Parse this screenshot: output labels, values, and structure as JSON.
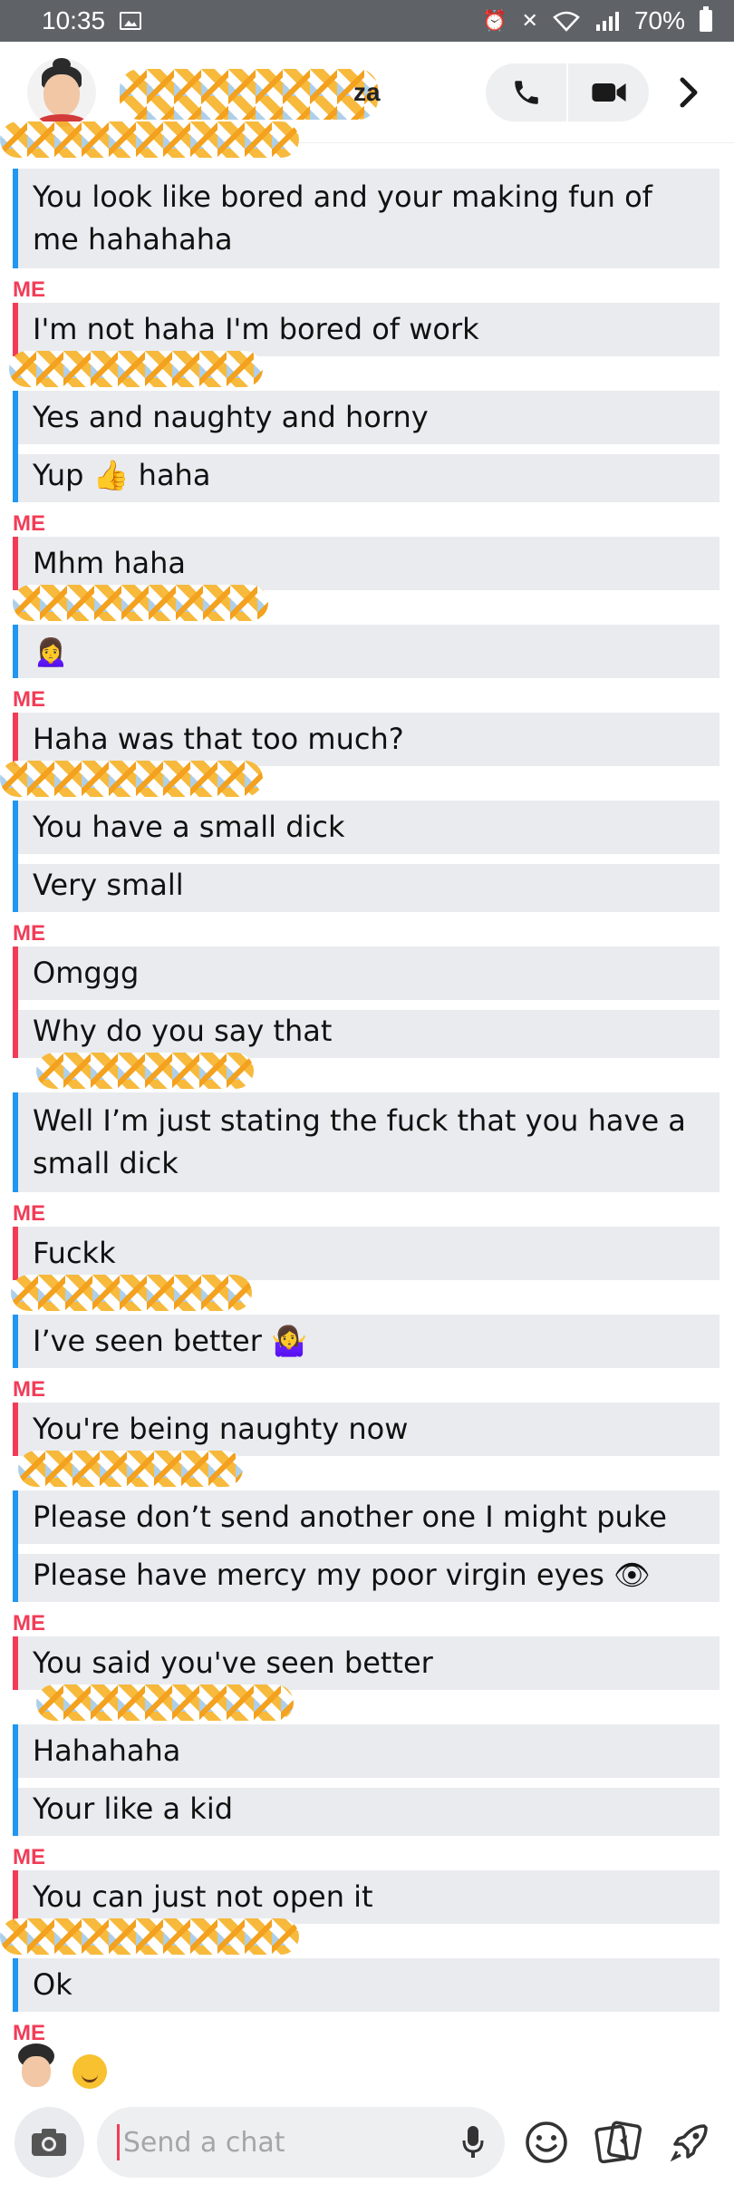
{
  "status_bar": {
    "time": "10:35",
    "battery": "70%"
  },
  "header": {
    "contact_name_visible": "za",
    "colors": {
      "me": "#f23c57",
      "them": "#2196f3"
    }
  },
  "icons": {
    "call": "phone-icon",
    "video": "video-icon",
    "forward": "chevron-right-icon",
    "camera": "camera-icon",
    "mic": "microphone-icon",
    "emoji": "smiley-icon",
    "stickers": "sticker-icon",
    "games": "rocket-icon"
  },
  "chat": {
    "groups": [
      {
        "sender": "them",
        "label": "",
        "messages": [
          "You look like bored and your making fun of me hahahaha"
        ]
      },
      {
        "sender": "me",
        "label": "ME",
        "messages": [
          "I'm not haha I'm bored of work"
        ]
      },
      {
        "sender": "them",
        "label": "",
        "messages": [
          "Yes and naughty and horny",
          "Yup 👍 haha"
        ]
      },
      {
        "sender": "me",
        "label": "ME",
        "messages": [
          "Mhm haha"
        ]
      },
      {
        "sender": "them",
        "label": "",
        "messages": [
          "🙍‍♀️"
        ]
      },
      {
        "sender": "me",
        "label": "ME",
        "messages": [
          "Haha was that too much?"
        ]
      },
      {
        "sender": "them",
        "label": "",
        "messages": [
          "You have a small dick",
          "Very small"
        ]
      },
      {
        "sender": "me",
        "label": "ME",
        "messages": [
          "Omggg",
          "Why do you say that"
        ]
      },
      {
        "sender": "them",
        "label": "",
        "messages": [
          "Well I’m just stating the fuck that you have a small dick"
        ]
      },
      {
        "sender": "me",
        "label": "ME",
        "messages": [
          "Fuckk"
        ]
      },
      {
        "sender": "them",
        "label": "",
        "messages": [
          "I’ve seen better 🤷‍♀️"
        ]
      },
      {
        "sender": "me",
        "label": "ME",
        "messages": [
          "You're being naughty now"
        ]
      },
      {
        "sender": "them",
        "label": "",
        "messages": [
          "Please don’t send another one I might puke",
          "Please have mercy my poor virgin eyes 👁"
        ]
      },
      {
        "sender": "me",
        "label": "ME",
        "messages": [
          "You said you've seen better"
        ]
      },
      {
        "sender": "them",
        "label": "",
        "messages": [
          "Hahahaha",
          "Your like a kid"
        ]
      },
      {
        "sender": "me",
        "label": "ME",
        "messages": [
          "You can just not open it"
        ]
      },
      {
        "sender": "them",
        "label": "",
        "messages": [
          "Ok"
        ]
      },
      {
        "sender": "me",
        "label": "ME",
        "messages": []
      }
    ]
  },
  "composer": {
    "placeholder": "Send a chat"
  }
}
